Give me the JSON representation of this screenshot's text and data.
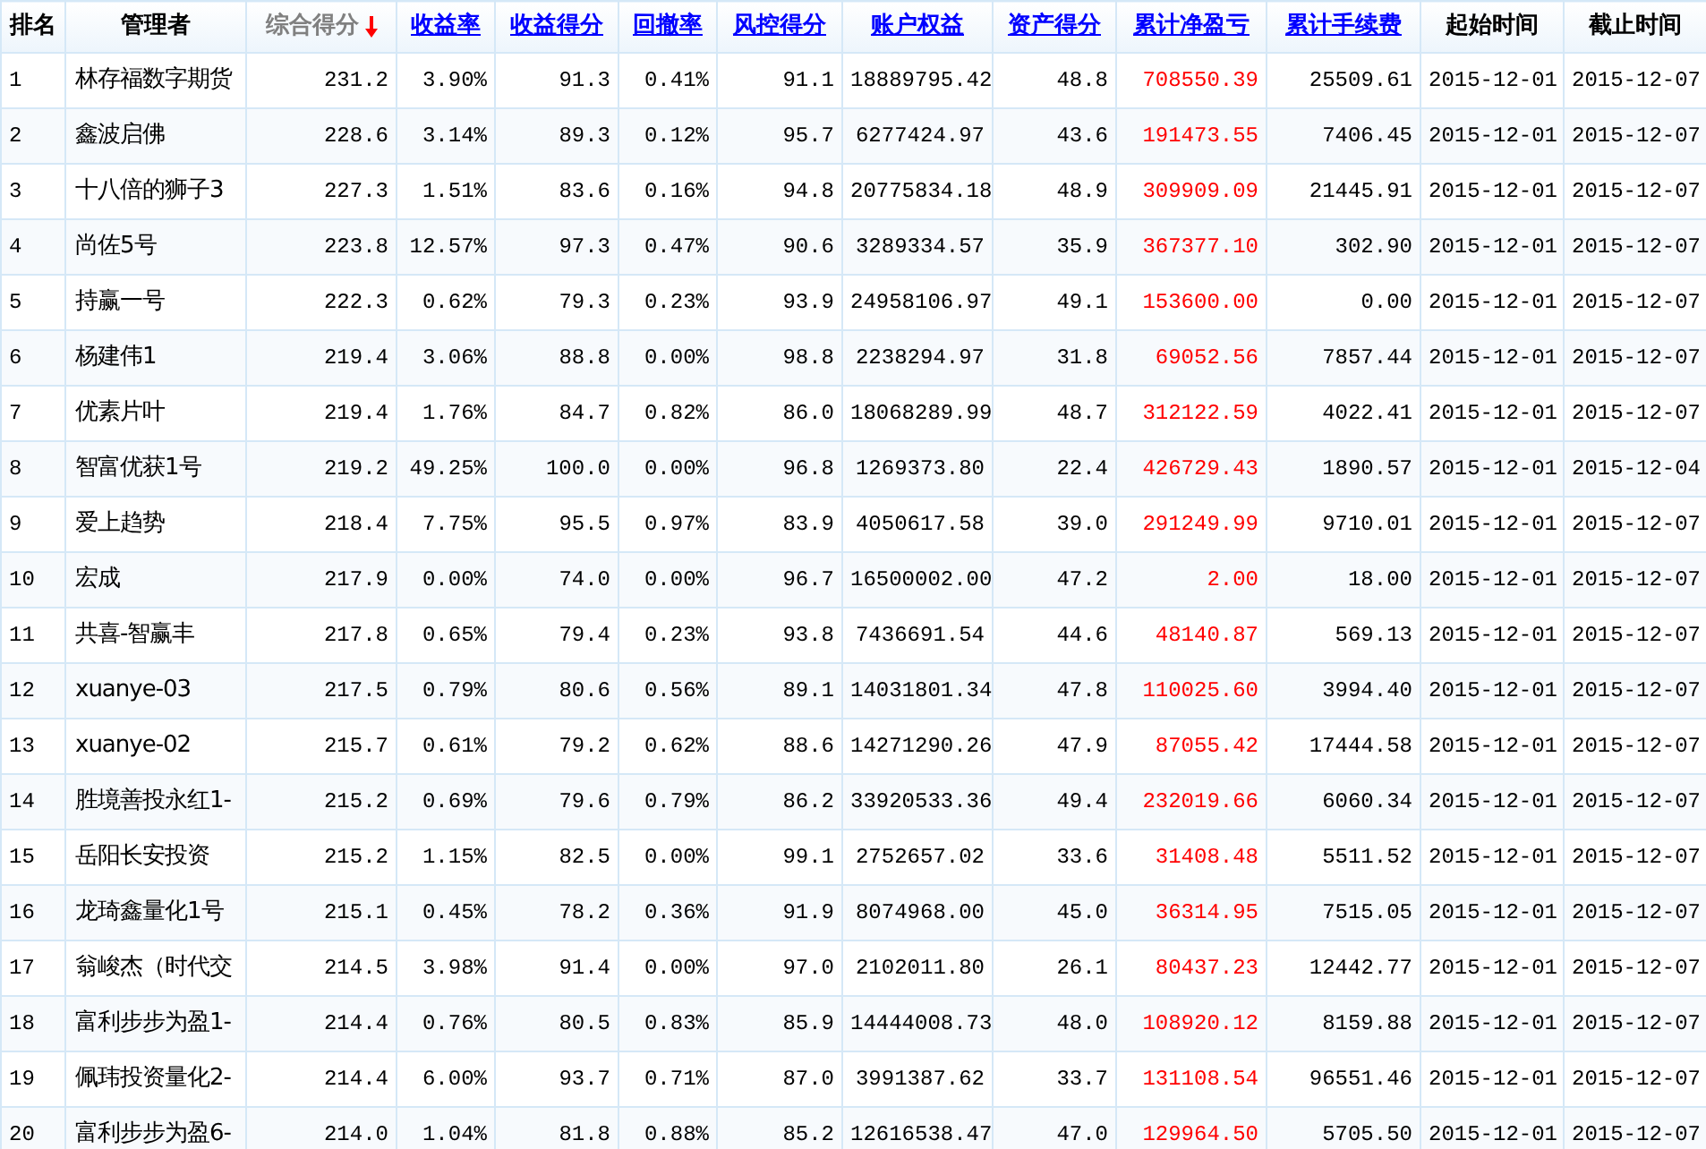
{
  "table": {
    "columns": [
      {
        "label": "排名",
        "kind": "plain",
        "highlighted": false
      },
      {
        "label": "管理者",
        "kind": "plain",
        "highlighted": false
      },
      {
        "label": "综合得分",
        "kind": "sorted",
        "highlighted": false
      },
      {
        "label": "收益率",
        "kind": "link",
        "highlighted": false
      },
      {
        "label": "收益得分",
        "kind": "link",
        "highlighted": false
      },
      {
        "label": "回撤率",
        "kind": "link",
        "highlighted": false
      },
      {
        "label": "风控得分",
        "kind": "link",
        "highlighted": false
      },
      {
        "label": "账户权益",
        "kind": "link",
        "highlighted": false
      },
      {
        "label": "资产得分",
        "kind": "link",
        "highlighted": false
      },
      {
        "label": "累计净盈亏",
        "kind": "link",
        "highlighted": true
      },
      {
        "label": "累计手续费",
        "kind": "link",
        "highlighted": false
      },
      {
        "label": "起始时间",
        "kind": "plain",
        "highlighted": false
      },
      {
        "label": "截止时间",
        "kind": "plain",
        "highlighted": false
      }
    ],
    "rows": [
      [
        "1",
        "林存福数字期货",
        "231.2",
        "3.90%",
        "91.3",
        "0.41%",
        "91.1",
        "18889795.42",
        "48.8",
        "708550.39",
        "25509.61",
        "2015-12-01",
        "2015-12-07"
      ],
      [
        "2",
        "鑫波启佛",
        "228.6",
        "3.14%",
        "89.3",
        "0.12%",
        "95.7",
        "6277424.97",
        "43.6",
        "191473.55",
        "7406.45",
        "2015-12-01",
        "2015-12-07"
      ],
      [
        "3",
        "十八倍的狮子3",
        "227.3",
        "1.51%",
        "83.6",
        "0.16%",
        "94.8",
        "20775834.18",
        "48.9",
        "309909.09",
        "21445.91",
        "2015-12-01",
        "2015-12-07"
      ],
      [
        "4",
        "尚佐5号",
        "223.8",
        "12.57%",
        "97.3",
        "0.47%",
        "90.6",
        "3289334.57",
        "35.9",
        "367377.10",
        "302.90",
        "2015-12-01",
        "2015-12-07"
      ],
      [
        "5",
        "持赢一号",
        "222.3",
        "0.62%",
        "79.3",
        "0.23%",
        "93.9",
        "24958106.97",
        "49.1",
        "153600.00",
        "0.00",
        "2015-12-01",
        "2015-12-07"
      ],
      [
        "6",
        "杨建伟1",
        "219.4",
        "3.06%",
        "88.8",
        "0.00%",
        "98.8",
        "2238294.97",
        "31.8",
        "69052.56",
        "7857.44",
        "2015-12-01",
        "2015-12-07"
      ],
      [
        "7",
        "优素片叶",
        "219.4",
        "1.76%",
        "84.7",
        "0.82%",
        "86.0",
        "18068289.99",
        "48.7",
        "312122.59",
        "4022.41",
        "2015-12-01",
        "2015-12-07"
      ],
      [
        "8",
        "智富优获1号",
        "219.2",
        "49.25%",
        "100.0",
        "0.00%",
        "96.8",
        "1269373.80",
        "22.4",
        "426729.43",
        "1890.57",
        "2015-12-01",
        "2015-12-04"
      ],
      [
        "9",
        "爱上趋势",
        "218.4",
        "7.75%",
        "95.5",
        "0.97%",
        "83.9",
        "4050617.58",
        "39.0",
        "291249.99",
        "9710.01",
        "2015-12-01",
        "2015-12-07"
      ],
      [
        "10",
        "宏成",
        "217.9",
        "0.00%",
        "74.0",
        "0.00%",
        "96.7",
        "16500002.00",
        "47.2",
        "2.00",
        "18.00",
        "2015-12-01",
        "2015-12-07"
      ],
      [
        "11",
        "共喜-智赢丰",
        "217.8",
        "0.65%",
        "79.4",
        "0.23%",
        "93.8",
        "7436691.54",
        "44.6",
        "48140.87",
        "569.13",
        "2015-12-01",
        "2015-12-07"
      ],
      [
        "12",
        "xuanye-03",
        "217.5",
        "0.79%",
        "80.6",
        "0.56%",
        "89.1",
        "14031801.34",
        "47.8",
        "110025.60",
        "3994.40",
        "2015-12-01",
        "2015-12-07"
      ],
      [
        "13",
        "xuanye-02",
        "215.7",
        "0.61%",
        "79.2",
        "0.62%",
        "88.6",
        "14271290.26",
        "47.9",
        "87055.42",
        "17444.58",
        "2015-12-01",
        "2015-12-07"
      ],
      [
        "14",
        "胜境善投永红1-",
        "215.2",
        "0.69%",
        "79.6",
        "0.79%",
        "86.2",
        "33920533.36",
        "49.4",
        "232019.66",
        "6060.34",
        "2015-12-01",
        "2015-12-07"
      ],
      [
        "15",
        "岳阳长安投资",
        "215.2",
        "1.15%",
        "82.5",
        "0.00%",
        "99.1",
        "2752657.02",
        "33.6",
        "31408.48",
        "5511.52",
        "2015-12-01",
        "2015-12-07"
      ],
      [
        "16",
        "龙琦鑫量化1号",
        "215.1",
        "0.45%",
        "78.2",
        "0.36%",
        "91.9",
        "8074968.00",
        "45.0",
        "36314.95",
        "7515.05",
        "2015-12-01",
        "2015-12-07"
      ],
      [
        "17",
        "翁峻杰（时代交",
        "214.5",
        "3.98%",
        "91.4",
        "0.00%",
        "97.0",
        "2102011.80",
        "26.1",
        "80437.23",
        "12442.77",
        "2015-12-01",
        "2015-12-07"
      ],
      [
        "18",
        "富利步步为盈1-",
        "214.4",
        "0.76%",
        "80.5",
        "0.83%",
        "85.9",
        "14444008.73",
        "48.0",
        "108920.12",
        "8159.88",
        "2015-12-01",
        "2015-12-07"
      ],
      [
        "19",
        "佩玮投资量化2-",
        "214.4",
        "6.00%",
        "93.7",
        "0.71%",
        "87.0",
        "3991387.62",
        "33.7",
        "131108.54",
        "96551.46",
        "2015-12-01",
        "2015-12-07"
      ],
      [
        "20",
        "富利步步为盈6-",
        "214.0",
        "1.04%",
        "81.8",
        "0.88%",
        "85.2",
        "12616538.47",
        "47.0",
        "129964.50",
        "5705.50",
        "2015-12-01",
        "2015-12-07"
      ]
    ]
  }
}
